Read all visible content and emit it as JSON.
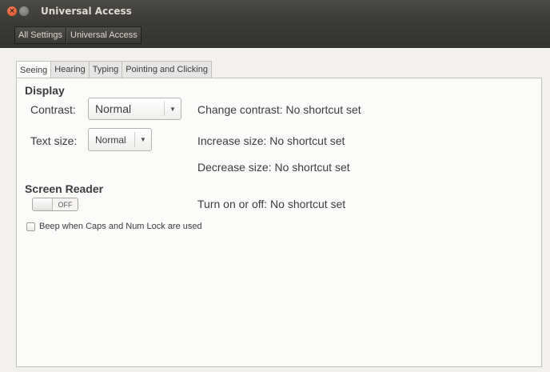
{
  "window": {
    "title": "Universal Access",
    "close_glyph": "×"
  },
  "breadcrumb": {
    "items": [
      "All Settings",
      "Universal Access"
    ]
  },
  "tabs": [
    {
      "label": "Seeing",
      "active": true
    },
    {
      "label": "Hearing",
      "active": false
    },
    {
      "label": "Typing",
      "active": false
    },
    {
      "label": "Pointing and Clicking",
      "active": false
    }
  ],
  "display": {
    "heading": "Display",
    "contrast_label": "Contrast:",
    "contrast_value": "Normal",
    "contrast_shortcut": "Change contrast: No shortcut set",
    "text_size_label": "Text size:",
    "text_size_value": "Normal",
    "increase_shortcut": "Increase size: No shortcut set",
    "decrease_shortcut": "Decrease size: No shortcut set",
    "dropdown_glyph": "▼"
  },
  "screen_reader": {
    "heading": "Screen Reader",
    "switch_state": "OFF",
    "toggle_shortcut": "Turn on or off: No shortcut set"
  },
  "beep": {
    "label": "Beep when Caps and Num Lock are used",
    "checked": false
  },
  "colors": {
    "titlebar": "#3c3b37",
    "window_bg": "#f2f1f0",
    "close_button": "#dd4814"
  }
}
